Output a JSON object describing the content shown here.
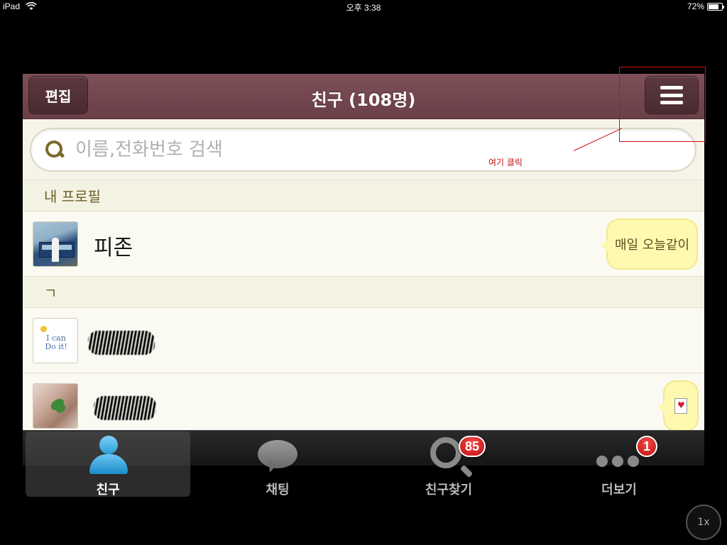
{
  "statusbar": {
    "device": "iPad",
    "time": "오후 3:38",
    "battery": "72%",
    "battery_level": 0.72
  },
  "navbar": {
    "title": "친구 (108명)",
    "edit_label": "편집",
    "menu_icon": "hamburger-icon"
  },
  "search": {
    "placeholder": "이름,전화번호 검색",
    "value": ""
  },
  "sections": {
    "my_profile": "내 프로필",
    "giyeok": "ㄱ"
  },
  "friends": [
    {
      "name": "피존",
      "status": "매일 오늘같이"
    },
    {
      "name": "",
      "status": ""
    },
    {
      "name": "",
      "status": ""
    }
  ],
  "annotation": {
    "text": "여기 클릭",
    "color": "#d01010"
  },
  "tabs": [
    {
      "label": "친구",
      "icon": "person-icon",
      "badge": ""
    },
    {
      "label": "채팅",
      "icon": "chat-bubble-icon",
      "badge": ""
    },
    {
      "label": "친구찾기",
      "icon": "magnifier-icon",
      "badge": "85"
    },
    {
      "label": "더보기",
      "icon": "more-dots-icon",
      "badge": "1"
    }
  ],
  "zoom": "1x",
  "colors": {
    "navbar": "#7e5058",
    "status_bubble": "#fff9b0",
    "badge": "#c21010",
    "accent_blue": "#2a9fd8"
  }
}
